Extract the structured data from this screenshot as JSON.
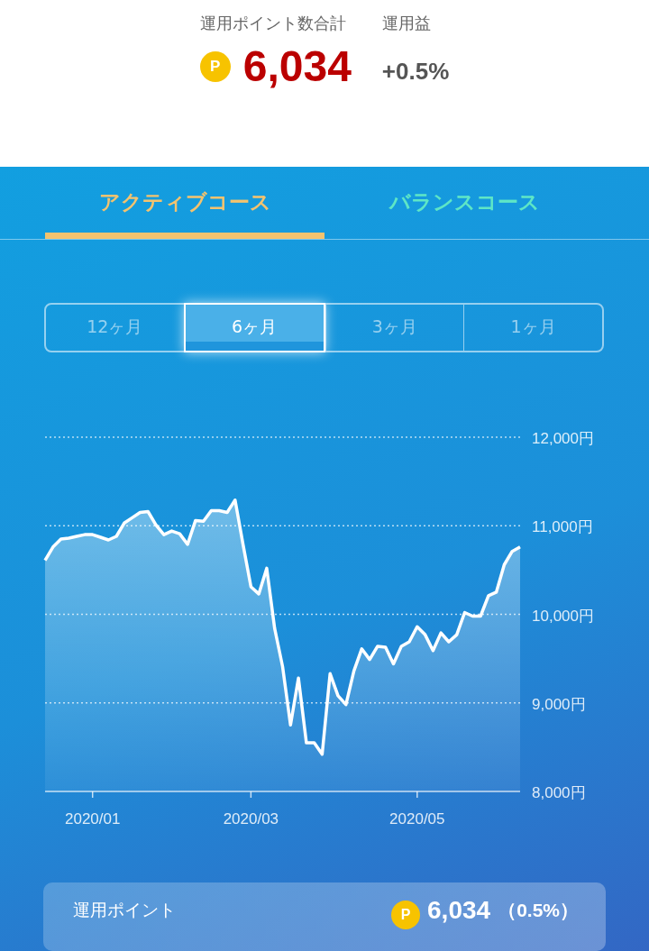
{
  "summary": {
    "points_label": "運用ポイント数合計",
    "coin": "P",
    "points_value": "6,034",
    "return_label": "運用益",
    "return_value": "+0.5%"
  },
  "course_tabs": [
    {
      "label": "アクティブコース",
      "selected": true
    },
    {
      "label": "バランスコース",
      "selected": false
    }
  ],
  "periods": [
    {
      "label": "12ヶ月",
      "selected": false
    },
    {
      "label": "6ヶ月",
      "selected": true
    },
    {
      "label": "3ヶ月",
      "selected": false
    },
    {
      "label": "1ヶ月",
      "selected": false
    }
  ],
  "chart_data": {
    "type": "area",
    "grid": true,
    "ylim": [
      8000,
      12000
    ],
    "categories": [
      null,
      null,
      null,
      null,
      null,
      null,
      "2020/01",
      null,
      null,
      null,
      null,
      null,
      null,
      null,
      null,
      null,
      null,
      null,
      null,
      null,
      null,
      null,
      null,
      null,
      null,
      null,
      "2020/03",
      null,
      null,
      null,
      null,
      null,
      null,
      null,
      null,
      null,
      null,
      null,
      null,
      null,
      null,
      null,
      null,
      null,
      null,
      null,
      null,
      "2020/05",
      null,
      null,
      null,
      null,
      null,
      null,
      null,
      null,
      null,
      null,
      null,
      null,
      null
    ],
    "yticks": [
      {
        "value": 8000,
        "label": "8,000円"
      },
      {
        "value": 9000,
        "label": "9,000円"
      },
      {
        "value": 10000,
        "label": "10,000円"
      },
      {
        "value": 11000,
        "label": "11,000円"
      },
      {
        "value": 12000,
        "label": "12,000円"
      }
    ],
    "series": [
      {
        "color": "#ffffff",
        "values": [
          10610,
          10760,
          10850,
          10860,
          10880,
          10900,
          10900,
          10870,
          10840,
          10880,
          11030,
          11090,
          11150,
          11160,
          11010,
          10900,
          10940,
          10910,
          10790,
          11060,
          11050,
          11170,
          11170,
          11150,
          11290,
          10790,
          10310,
          10230,
          10520,
          9840,
          9410,
          8750,
          9280,
          8550,
          8550,
          8420,
          9330,
          9080,
          8980,
          9360,
          9610,
          9490,
          9640,
          9630,
          9440,
          9640,
          9690,
          9860,
          9770,
          9590,
          9790,
          9690,
          9770,
          10020,
          9980,
          9980,
          10210,
          10250,
          10560,
          10710,
          10760
        ]
      }
    ]
  },
  "card": {
    "label": "運用ポイント",
    "coin": "P",
    "value": "6,034",
    "rate": "（0.5%）"
  }
}
